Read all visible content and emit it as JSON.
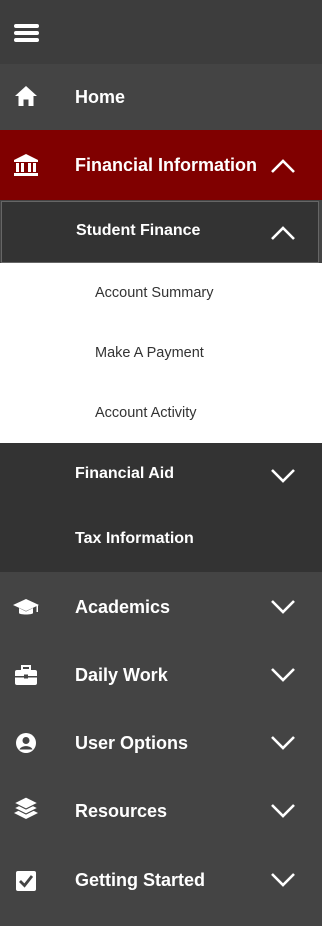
{
  "menu": {
    "toggle_icon": "hamburger-icon",
    "home": {
      "label": "Home",
      "icon": "home-icon"
    },
    "financial_information": {
      "label": "Financial Information",
      "icon": "bank-icon",
      "expanded": true,
      "accent_color": "#800000",
      "student_finance": {
        "label": "Student Finance",
        "expanded": true,
        "links": [
          "Account Summary",
          "Make A Payment",
          "Account Activity"
        ]
      },
      "financial_aid": {
        "label": "Financial Aid",
        "expanded": false
      },
      "tax_information": {
        "label": "Tax Information"
      }
    },
    "academics": {
      "label": "Academics",
      "icon": "graduation-cap-icon"
    },
    "daily_work": {
      "label": "Daily Work",
      "icon": "briefcase-icon"
    },
    "user_options": {
      "label": "User Options",
      "icon": "user-circle-icon"
    },
    "resources": {
      "label": "Resources",
      "icon": "books-icon"
    },
    "getting_started": {
      "label": "Getting Started",
      "icon": "checkbox-icon"
    }
  }
}
